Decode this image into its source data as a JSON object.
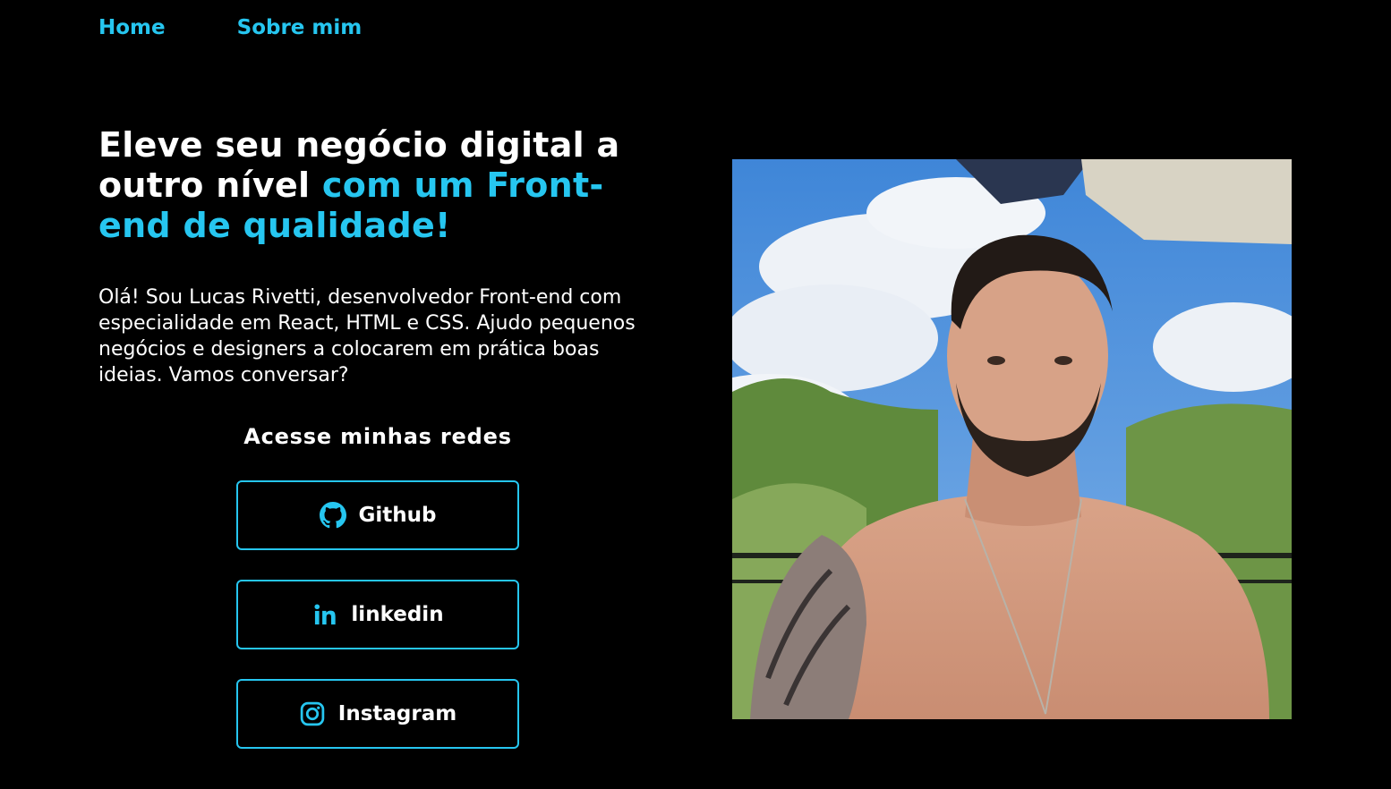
{
  "nav": {
    "home_label": "Home",
    "about_label": "Sobre mim"
  },
  "hero": {
    "headline_white": "Eleve seu negócio digital a outro nível",
    "headline_accent": "com um Front-end de qualidade!",
    "intro": "Olá! Sou Lucas Rivetti, desenvolvedor Front-end com especialidade em React, HTML e CSS. Ajudo pequenos negócios e designers a colocarem em prática boas ideias. Vamos conversar?"
  },
  "social": {
    "title": "Acesse minhas redes",
    "links": [
      {
        "label": "Github",
        "icon": "github-icon"
      },
      {
        "label": "linkedin",
        "icon": "linkedin-icon"
      },
      {
        "label": "Instagram",
        "icon": "instagram-icon"
      }
    ]
  },
  "colors": {
    "background": "#000000",
    "accent": "#26c6f0",
    "text": "#ffffff"
  }
}
